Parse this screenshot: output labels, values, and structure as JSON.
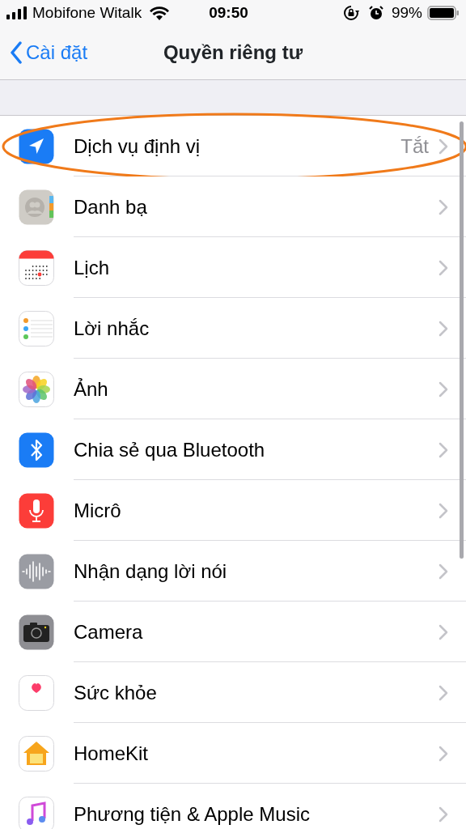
{
  "status_bar": {
    "carrier": "Mobifone Witalk",
    "time": "09:50",
    "battery": "99%"
  },
  "nav": {
    "back": "Cài đặt",
    "title": "Quyền riêng tư"
  },
  "items": [
    {
      "label": "Dịch vụ định vị",
      "value": "Tắt",
      "highlighted": true
    },
    {
      "label": "Danh bạ",
      "highlighted": false
    },
    {
      "label": "Lịch",
      "highlighted": false
    },
    {
      "label": "Lời nhắc",
      "highlighted": false
    },
    {
      "label": "Ảnh",
      "highlighted": false
    },
    {
      "label": "Chia sẻ qua Bluetooth",
      "highlighted": false
    },
    {
      "label": "Micrô",
      "highlighted": false
    },
    {
      "label": "Nhận dạng lời nói",
      "highlighted": false
    },
    {
      "label": "Camera",
      "highlighted": false
    },
    {
      "label": "Sức khỏe",
      "highlighted": false
    },
    {
      "label": "HomeKit",
      "highlighted": false
    },
    {
      "label": "Phương tiện & Apple Music",
      "highlighted": false
    }
  ]
}
